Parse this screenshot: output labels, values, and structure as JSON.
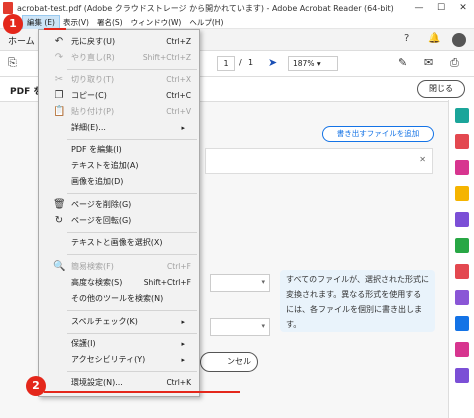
{
  "titlebar": {
    "title": "acrobat-test.pdf (Adobe クラウドストレージ から開かれています) - Adobe Acrobat Reader (64-bit)",
    "minimize": "—",
    "maximize": "☐",
    "close": "✕"
  },
  "menubar": {
    "items": [
      "ファ",
      "編集 (E)",
      "表示(V)",
      "署名(S)",
      "ウィンドウ(W)",
      "ヘルプ(H)"
    ]
  },
  "tabbar": {
    "home": "ホーム"
  },
  "toolbar": {
    "page_current": "1",
    "page_sep": "/",
    "page_total": "1",
    "zoom": "187%"
  },
  "panel": {
    "title": "PDF を",
    "close_button": "閉じる",
    "add_files_button": "書き出すファイルを追加",
    "file_close": "✕",
    "info_text": "すべてのファイルが、選択された形式に変換されます。異なる形式を使用するには、各ファイルを個別に書き出します。",
    "cancel_button": "ンセル"
  },
  "edit_menu": {
    "undo": {
      "label": "元に戻す(U)",
      "shortcut": "Ctrl+Z"
    },
    "redo": {
      "label": "やり直し(R)",
      "shortcut": "Shift+Ctrl+Z"
    },
    "cut": {
      "label": "切り取り(T)",
      "shortcut": "Ctrl+X"
    },
    "copy": {
      "label": "コピー(C)",
      "shortcut": "Ctrl+C"
    },
    "paste": {
      "label": "貼り付け(P)",
      "shortcut": "Ctrl+V"
    },
    "details": {
      "label": "詳細(E)..."
    },
    "edit_pdf": {
      "label": "PDF を編集(I)"
    },
    "add_text": {
      "label": "テキストを追加(A)"
    },
    "add_image": {
      "label": "画像を追加(D)"
    },
    "delete_page": {
      "label": "ページを削除(G)"
    },
    "rotate_page": {
      "label": "ページを回転(G)"
    },
    "select_text_image": {
      "label": "テキストと画像を選択(X)"
    },
    "quick_search": {
      "label": "簡易検索(F)",
      "shortcut": "Ctrl+F"
    },
    "advanced_search": {
      "label": "高度な検索(S)",
      "shortcut": "Shift+Ctrl+F"
    },
    "other_tools_search": {
      "label": "その他のツールを検索(N)"
    },
    "spell_check": {
      "label": "スペルチェック(K)"
    },
    "protect": {
      "label": "保護(I)"
    },
    "accessibility": {
      "label": "アクセシビリティ(Y)"
    },
    "preferences": {
      "label": "環境設定(N)...",
      "shortcut": "Ctrl+K"
    }
  },
  "annotations": {
    "badge1": "1",
    "badge2": "2"
  },
  "colors": {
    "accent_red": "#e4271b",
    "adobe_blue": "#1473e6"
  }
}
